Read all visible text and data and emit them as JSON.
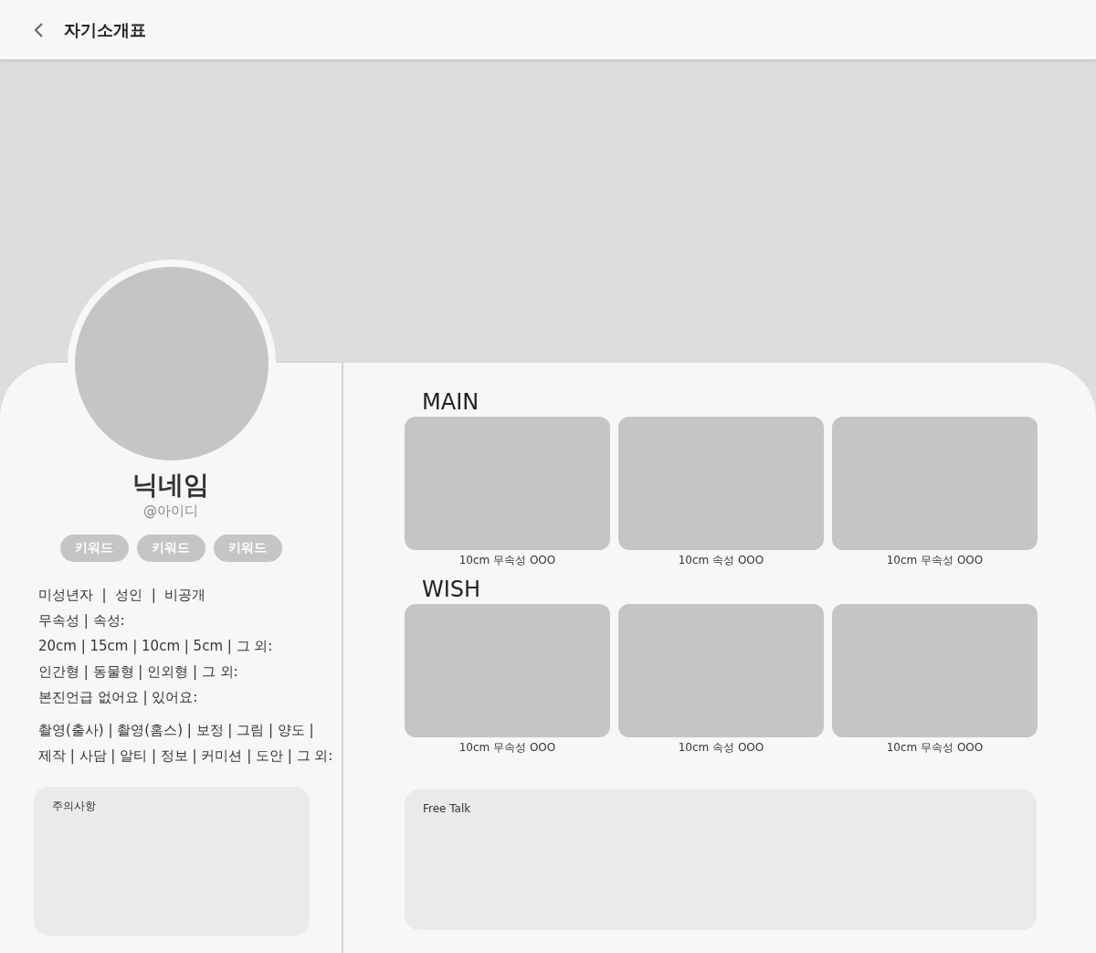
{
  "header": {
    "title": "자기소개표"
  },
  "profile": {
    "name": "닉네임",
    "handle": "@아이디",
    "keywords": [
      "키워드",
      "키워드",
      "키워드"
    ],
    "info_groups": [
      {
        "lines": [
          "미성년자  |  성인  |  비공개",
          "무속성 | 속성:",
          "20cm | 15cm | 10cm | 5cm | 그 외:",
          "인간형 | 동물형 | 인외형 | 그 외:",
          "본진언급 없어요 | 있어요:"
        ]
      },
      {
        "lines": [
          "촬영(출사) | 촬영(홈스) | 보정 | 그림 | 양도 |",
          "제작 | 사담 | 알티 | 정보 | 커미션 | 도안 | 그 외:"
        ]
      }
    ]
  },
  "caution": {
    "label": "주의사항"
  },
  "sections": [
    {
      "title": "MAIN",
      "items": [
        {
          "caption": "10cm 무속성 OOO"
        },
        {
          "caption": "10cm 속성 OOO"
        },
        {
          "caption": "10cm 무속성 OOO"
        }
      ]
    },
    {
      "title": "WISH",
      "items": [
        {
          "caption": "10cm 무속성 OOO"
        },
        {
          "caption": "10cm 속성 OOO"
        },
        {
          "caption": "10cm 무속성 OOO"
        }
      ]
    }
  ],
  "free_talk": {
    "label": "Free Talk"
  }
}
